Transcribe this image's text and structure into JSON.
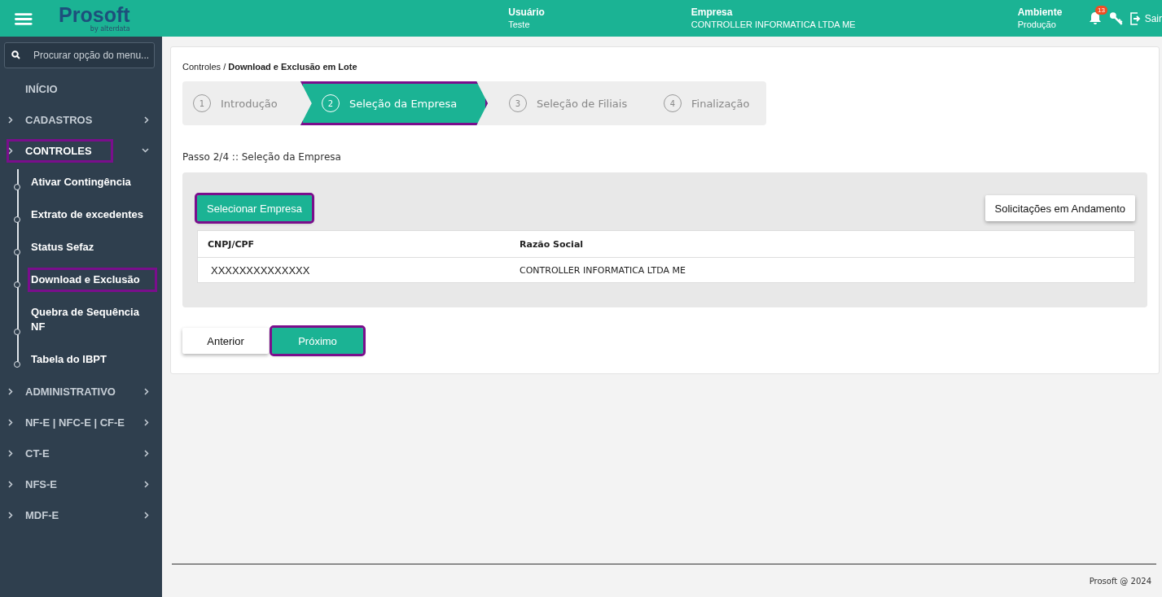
{
  "header": {
    "logo": {
      "name": "Prosoft",
      "tagline": "by alterdata"
    },
    "info": [
      {
        "label": "Usuário",
        "value": "Teste"
      },
      {
        "label": "Empresa",
        "value": "CONTROLLER INFORMATICA LTDA ME"
      },
      {
        "label": "Ambiente",
        "value": "Produção"
      }
    ],
    "notifications": "13",
    "logout": "Sair"
  },
  "sidebar": {
    "search": {
      "placeholder": "Procurar opção do menu..."
    },
    "items": [
      {
        "label": "INÍCIO",
        "kind": "plain",
        "expanded": false,
        "highlighted": false
      },
      {
        "label": "CADASTROS",
        "kind": "group",
        "expanded": false,
        "highlighted": false
      },
      {
        "label": "CONTROLES",
        "kind": "group",
        "expanded": true,
        "highlighted": true,
        "children": [
          {
            "label": "Ativar Contingência",
            "highlighted": false
          },
          {
            "label": "Extrato de excedentes",
            "highlighted": false
          },
          {
            "label": "Status Sefaz",
            "highlighted": false
          },
          {
            "label": "Download e Exclusão",
            "highlighted": true
          },
          {
            "label": "Quebra de Sequência NF",
            "highlighted": false
          },
          {
            "label": "Tabela do IBPT",
            "highlighted": false
          }
        ]
      },
      {
        "label": "ADMINISTRATIVO",
        "kind": "group",
        "expanded": false,
        "highlighted": false
      },
      {
        "label": "NF-E | NFC-E | CF-E",
        "kind": "group",
        "expanded": false,
        "highlighted": false
      },
      {
        "label": "CT-E",
        "kind": "group",
        "expanded": false,
        "highlighted": false
      },
      {
        "label": "NFS-E",
        "kind": "group",
        "expanded": false,
        "highlighted": false
      },
      {
        "label": "MDF-E",
        "kind": "group",
        "expanded": false,
        "highlighted": false
      }
    ]
  },
  "breadcrumb": {
    "parent": "Controles / ",
    "current": "Download e Exclusão em Lote"
  },
  "steps": [
    {
      "number": "1",
      "label": "Introdução",
      "selected": false,
      "highlighted": false
    },
    {
      "number": "2",
      "label": "Seleção da Empresa",
      "selected": true,
      "highlighted": true
    },
    {
      "number": "3",
      "label": "Seleção de Filiais",
      "selected": false,
      "highlighted": false
    },
    {
      "number": "4",
      "label": "Finalização",
      "selected": false,
      "highlighted": false
    }
  ],
  "step_title": "Passo 2/4 :: Seleção da Empresa",
  "panel": {
    "select_button": {
      "label": "Selecionar Empresa",
      "highlighted": true
    },
    "requests_button": {
      "label": "Solicitações em Andamento",
      "highlighted": false
    },
    "table": {
      "columns": [
        "CNPJ/CPF",
        "Razão Social"
      ],
      "rows": [
        [
          "XXXXXXXXXXXXXX",
          "CONTROLLER INFORMATICA LTDA ME"
        ]
      ]
    }
  },
  "nav_buttons": [
    {
      "label": "Anterior",
      "kind": "secondary",
      "highlighted": false
    },
    {
      "label": "Próximo",
      "kind": "primary",
      "highlighted": true
    }
  ],
  "footer": "Prosoft @ 2024"
}
